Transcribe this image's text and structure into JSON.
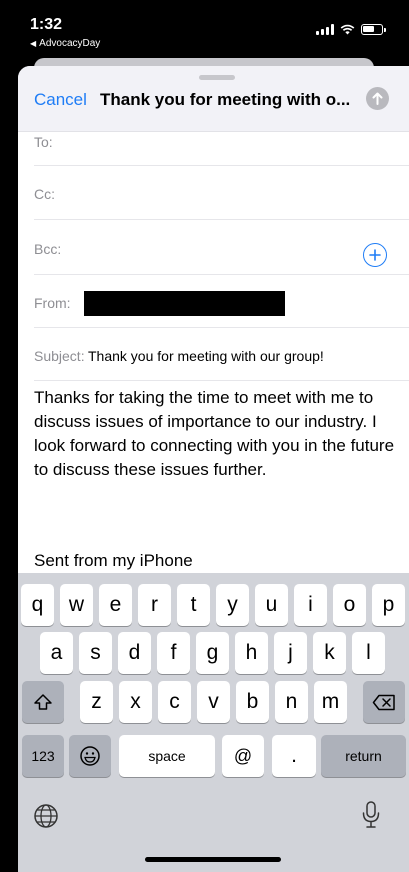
{
  "status": {
    "time": "1:32",
    "back_app": "AdvocacyDay"
  },
  "compose": {
    "cancel_label": "Cancel",
    "title": "Thank you for meeting with o...",
    "to_label": "To:",
    "cc_label": "Cc:",
    "bcc_label": "Bcc:",
    "from_label": "From:",
    "subject_label": "Subject:",
    "subject_value": "Thank you for meeting with our group!",
    "body": "Thanks for taking the time to meet with me to discuss issues of importance to our industry. I look forward to connecting with you in the future to discuss these issues further.",
    "signature": "Sent from my iPhone"
  },
  "keyboard": {
    "row1": [
      "q",
      "w",
      "e",
      "r",
      "t",
      "y",
      "u",
      "i",
      "o",
      "p"
    ],
    "row2": [
      "a",
      "s",
      "d",
      "f",
      "g",
      "h",
      "j",
      "k",
      "l"
    ],
    "row3": [
      "z",
      "x",
      "c",
      "v",
      "b",
      "n",
      "m"
    ],
    "numbers_label": "123",
    "space_label": "space",
    "at_label": "@",
    "dot_label": ".",
    "return_label": "return"
  },
  "icons": {
    "send": "arrow-up-circle-icon",
    "add_recipient": "plus-circle-icon",
    "shift": "shift-icon",
    "delete": "delete-icon",
    "emoji": "emoji-icon",
    "globe": "globe-icon",
    "mic": "microphone-icon"
  },
  "colors": {
    "accent": "#1f7df6",
    "keyboard_bg": "#d1d3d9",
    "key_dark": "#adb1ba"
  }
}
